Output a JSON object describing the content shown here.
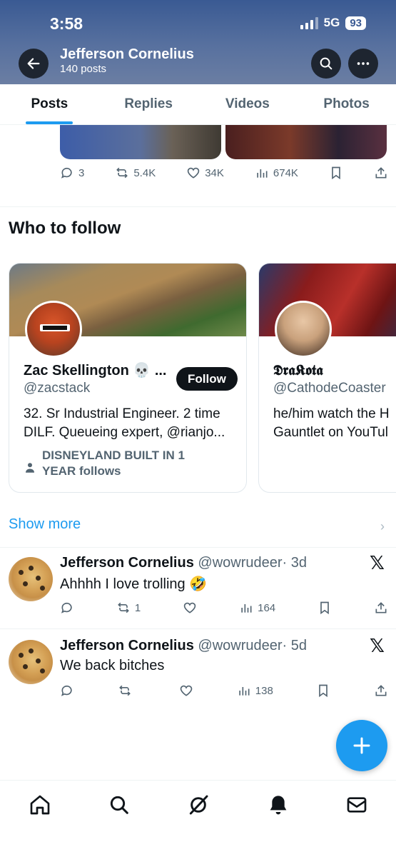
{
  "status_bar": {
    "time": "3:58",
    "network": "5G",
    "battery": "93"
  },
  "header": {
    "name": "Jefferson Cornelius",
    "post_count": "140 posts"
  },
  "tabs": [
    {
      "label": "Posts",
      "active": true
    },
    {
      "label": "Replies",
      "active": false
    },
    {
      "label": "Videos",
      "active": false
    },
    {
      "label": "Photos",
      "active": false
    }
  ],
  "top_post": {
    "replies": "3",
    "reposts": "5.4K",
    "likes": "34K",
    "views": "674K"
  },
  "who_to_follow": {
    "title": "Who to follow",
    "cards": [
      {
        "name": "Zac Skellington 💀 ...",
        "handle": "@zacstack",
        "bio_line1": "32. Sr Industrial Engineer. 2 time",
        "bio_line2": "DILF. Queueing expert, @rianjo...",
        "follow_label": "Follow",
        "follows_line1": "DISNEYLAND BUILT IN 1",
        "follows_line2": "YEAR follows"
      },
      {
        "name": "𝕯𝖗𝖆𝕶𝖔𝖙𝖆",
        "handle": "@CathodeCoaster",
        "bio_line1": "he/him watch the H",
        "bio_line2": "Gauntlet on YouTul"
      }
    ],
    "show_more": "Show more"
  },
  "tweets": [
    {
      "name": "Jefferson Cornelius",
      "handle": "@wowrudeer",
      "time": "· 3d",
      "text": "Ahhhh I love trolling 🤣",
      "reposts": "1",
      "views": "164"
    },
    {
      "name": "Jefferson Cornelius",
      "handle": "@wowrudeer",
      "time": "· 5d",
      "text": "We back bitches",
      "reposts": "",
      "views": "138"
    }
  ],
  "colors": {
    "accent": "#1d9bf0",
    "text": "#0f1419",
    "muted": "#536471"
  },
  "icons": [
    "back-arrow-icon",
    "search-icon",
    "more-icon",
    "reply-icon",
    "repost-icon",
    "like-icon",
    "views-icon",
    "bookmark-icon",
    "share-icon",
    "x-logo-icon",
    "compose-icon",
    "home-icon",
    "grok-icon",
    "notifications-icon",
    "messages-icon"
  ]
}
